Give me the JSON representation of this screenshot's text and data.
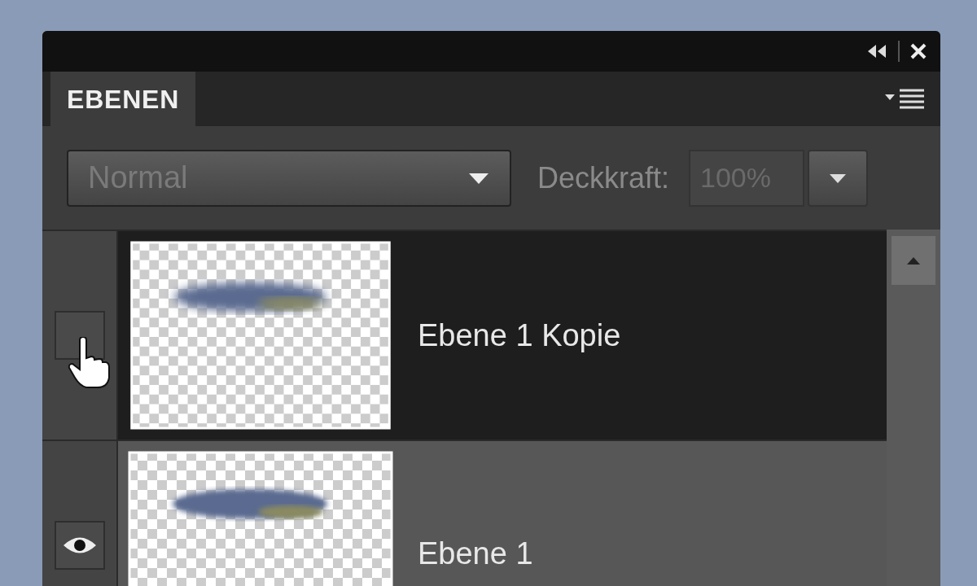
{
  "tabs": [
    {
      "label": "EBENEN",
      "selected": true
    }
  ],
  "blend_mode": {
    "value": "Normal",
    "disabled": true
  },
  "opacity": {
    "label": "Deckkraft:",
    "value": "100%",
    "disabled": true
  },
  "layers": [
    {
      "name": "Ebene 1 Kopie",
      "visible": false,
      "selected": true
    },
    {
      "name": "Ebene 1",
      "visible": true,
      "selected": false
    }
  ]
}
